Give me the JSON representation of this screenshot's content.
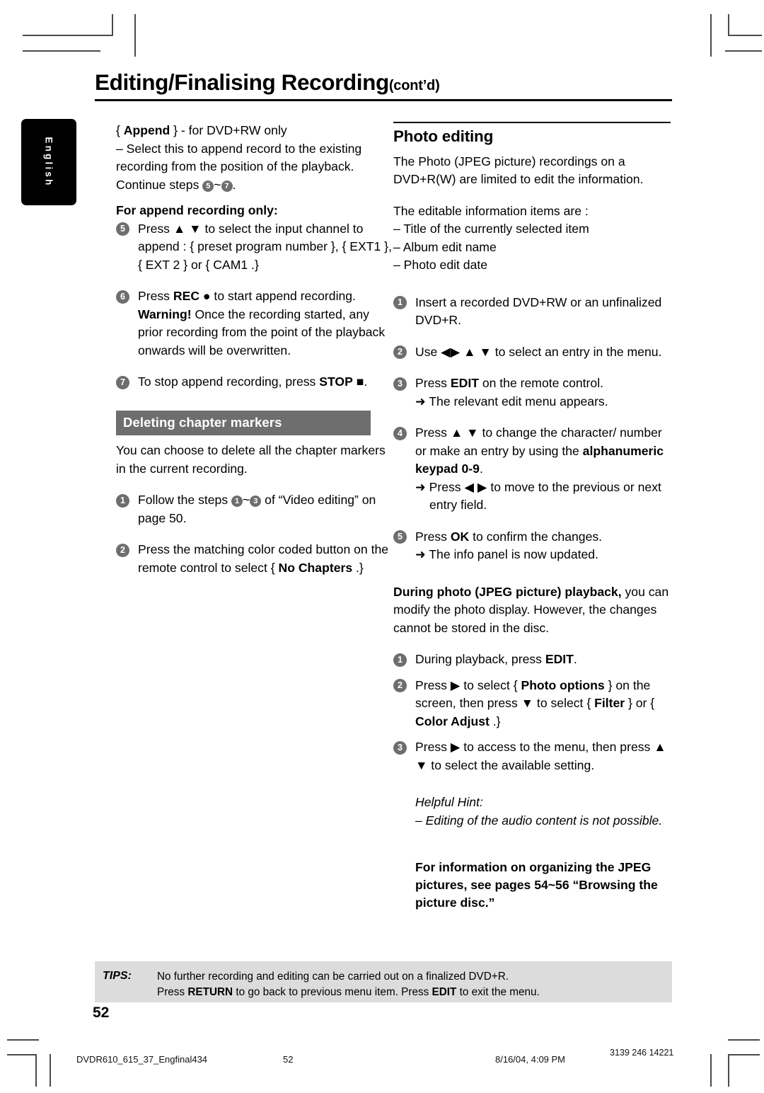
{
  "language_tab": {
    "label": "English"
  },
  "header": {
    "title": "Editing/Finalising Recording",
    "title_suffix": "(cont’d)"
  },
  "left_column": {
    "append_heading": "{ Append } - for DVD+RW only",
    "append_heading_term": "Append",
    "append_desc": "–  Select this to append record to the existing recording from the position of the playback.  Continue steps",
    "append_desc_tail": ".",
    "append_step_from": "5",
    "append_step_to": "7",
    "append_only_heading": "For append recording only:",
    "steps": [
      {
        "num": "5",
        "text": "Press ▲ ▼ to select the input channel to append : { preset program number }, { EXT1 }, { EXT 2 } or { CAM1 .}"
      },
      {
        "num": "6",
        "line1_pre": "Press ",
        "line1_bold": "REC",
        "line1_post": " ● to start append recording.",
        "line2_bold": "Warning!",
        "line2_text": "  Once the recording started, any prior recording from the point of the playback onwards will be overwritten."
      },
      {
        "num": "7",
        "line1": "To stop append recording, press",
        "line2_bold": "STOP",
        "line2_post": " ■."
      }
    ],
    "deleting_section": {
      "heading": "Deleting chapter markers",
      "intro": "You can choose to delete all the chapter markers in the current recording.",
      "steps": [
        {
          "num": "1",
          "pre": "Follow the steps ",
          "ref_from": "1",
          "ref_to": "3",
          "post": " of “Video editing” on page 50."
        },
        {
          "num": "2",
          "pre": "Press the matching color coded button on the remote control to select { ",
          "bold": "No Chapters",
          "post": " .}"
        }
      ]
    }
  },
  "right_column": {
    "photo_editing": {
      "heading": "Photo editing",
      "intro": "The Photo (JPEG picture) recordings on a DVD+R(W) are limited to edit the information.",
      "items_intro": "The editable information items are :",
      "items": [
        "–  Title of the currently selected item",
        "–  Album edit name",
        "–  Photo edit date"
      ],
      "steps": [
        {
          "num": "1",
          "text": "Insert a recorded DVD+RW or an unfinalized DVD+R."
        },
        {
          "num": "2",
          "text": "Use ◀▶ ▲ ▼ to select an entry in the menu."
        },
        {
          "num": "3",
          "pre": "Press ",
          "bold": "EDIT",
          "post": " on the remote control.",
          "arrow": "➜ The relevant edit menu appears."
        },
        {
          "num": "4",
          "pre": "Press ▲ ▼ to change the character/ number or make an entry by using the ",
          "bold": "alphanumeric keypad 0-9",
          "post": ".",
          "arrow": "➜ Press ◀ ▶ to move to the previous or next entry field."
        },
        {
          "num": "5",
          "pre": "Press ",
          "bold": "OK",
          "post": " to confirm the changes.",
          "arrow": "➜ The info panel is now updated."
        }
      ]
    },
    "during_playback": {
      "lead_bold": "During photo (JPEG picture) playback,",
      "lead_text": " you can modify the photo display. However, the changes cannot be stored in the disc.",
      "steps": [
        {
          "num": "1",
          "pre": "During playback, press ",
          "bold": "EDIT",
          "post": "."
        },
        {
          "num": "2",
          "pre": "Press ▶ to select { ",
          "bold": "Photo options",
          "mid": " } on the screen, then press ▼ to select { ",
          "bold2": "Filter",
          "mid2": " } or { ",
          "bold3": "Color Adjust",
          "post": " .}"
        },
        {
          "num": "3",
          "text": "Press ▶ to access to the menu, then press ▲ ▼ to select the available setting."
        }
      ],
      "hint_title": "Helpful Hint:",
      "hint_text": "–  Editing of the audio content is not possible."
    },
    "footnote": "For information on organizing the JPEG pictures, see pages 54~56 “Browsing the picture disc.”"
  },
  "tips": {
    "label": "TIPS:",
    "line1": "No further recording and editing can be carried out on a finalized DVD+R.",
    "line2_a": "Press ",
    "line2_b": "RETURN",
    "line2_c": " to go back to previous menu item.  Press ",
    "line2_d": "EDIT",
    "line2_e": " to exit the menu."
  },
  "page_number": "52",
  "footer": {
    "file": "DVDR610_615_37_Engfinal434",
    "page": "52",
    "date": "8/16/04, 4:09 PM",
    "code": "3139 246 14221"
  },
  "colors": {
    "bullet_gray": "#6e6e6e",
    "tips_bg": "#dcdcdc",
    "tab_black": "#000000"
  }
}
